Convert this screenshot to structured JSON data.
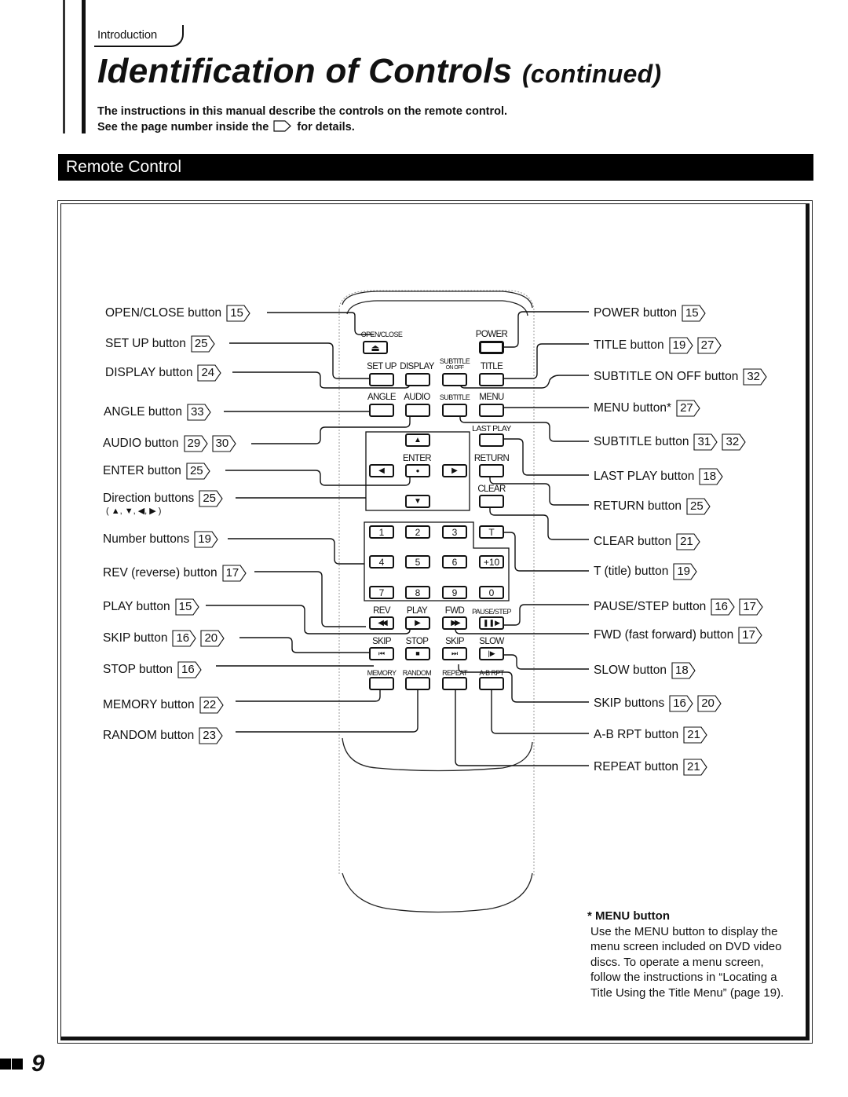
{
  "header": {
    "breadcrumb": "Introduction",
    "title": "Identification of Controls",
    "title_suffix": "(continued)",
    "intro_line1": "The instructions in this manual describe the controls on the remote control.",
    "intro_line2_before": "See the page number inside the",
    "intro_line2_after": "for details."
  },
  "section": {
    "title": "Remote Control"
  },
  "left_labels": [
    {
      "text": "OPEN/CLOSE button",
      "refs": [
        "15"
      ]
    },
    {
      "text": "SET UP button",
      "refs": [
        "25"
      ]
    },
    {
      "text": "DISPLAY button",
      "refs": [
        "24"
      ]
    },
    {
      "text": "ANGLE button",
      "refs": [
        "33"
      ]
    },
    {
      "text": "AUDIO button",
      "refs": [
        "29",
        "30"
      ]
    },
    {
      "text": "ENTER button",
      "refs": [
        "25"
      ]
    },
    {
      "text": "Direction buttons",
      "refs": [
        "25"
      ],
      "subtext": "( ▲, ▼, ◀, ▶ )"
    },
    {
      "text": "Number buttons",
      "refs": [
        "19"
      ]
    },
    {
      "text": "REV (reverse) button",
      "refs": [
        "17"
      ]
    },
    {
      "text": "PLAY button",
      "refs": [
        "15"
      ]
    },
    {
      "text": "SKIP button",
      "refs": [
        "16",
        "20"
      ]
    },
    {
      "text": "STOP button",
      "refs": [
        "16"
      ]
    },
    {
      "text": "MEMORY button",
      "refs": [
        "22"
      ]
    },
    {
      "text": "RANDOM button",
      "refs": [
        "23"
      ]
    }
  ],
  "right_labels": [
    {
      "text": "POWER button",
      "refs": [
        "15"
      ]
    },
    {
      "text": "TITLE button",
      "refs": [
        "19",
        "27"
      ]
    },
    {
      "text": "SUBTITLE ON OFF button",
      "refs": [
        "32"
      ]
    },
    {
      "text": "MENU button*",
      "refs": [
        "27"
      ]
    },
    {
      "text": "SUBTITLE button",
      "refs": [
        "31",
        "32"
      ]
    },
    {
      "text": "LAST PLAY button",
      "refs": [
        "18"
      ]
    },
    {
      "text": "RETURN button",
      "refs": [
        "25"
      ]
    },
    {
      "text": "CLEAR button",
      "refs": [
        "21"
      ]
    },
    {
      "text": "T (title) button",
      "refs": [
        "19"
      ]
    },
    {
      "text": "PAUSE/STEP button",
      "refs": [
        "16",
        "17"
      ]
    },
    {
      "text": "FWD (fast forward) button",
      "refs": [
        "17"
      ]
    },
    {
      "text": "SLOW button",
      "refs": [
        "18"
      ]
    },
    {
      "text": "SKIP buttons",
      "refs": [
        "16",
        "20"
      ]
    },
    {
      "text": "A-B RPT button",
      "refs": [
        "21"
      ]
    },
    {
      "text": "REPEAT button",
      "refs": [
        "21"
      ]
    }
  ],
  "remote": {
    "open_close": "OPEN/CLOSE",
    "power": "POWER",
    "set_up": "SET UP",
    "display": "DISPLAY",
    "subtitle_onoff": "SUBTITLE",
    "subtitle_onoff_sub": "ON OFF",
    "title": "TITLE",
    "angle": "ANGLE",
    "audio": "AUDIO",
    "subtitle": "SUBTITLE",
    "menu": "MENU",
    "last_play": "LAST PLAY",
    "enter": "ENTER",
    "return": "RETURN",
    "clear": "CLEAR",
    "numbers": [
      "1",
      "2",
      "3",
      "T",
      "4",
      "5",
      "6",
      "+10",
      "7",
      "8",
      "9",
      "0"
    ],
    "rev": "REV",
    "play": "PLAY",
    "fwd": "FWD",
    "pause_step": "PAUSE/STEP",
    "skip_back": "SKIP",
    "stop": "STOP",
    "skip_fwd": "SKIP",
    "slow": "SLOW",
    "memory": "MEMORY",
    "random": "RANDOM",
    "repeat": "REPEAT",
    "ab_rpt": "A-B RPT"
  },
  "note": {
    "title": "* MENU button",
    "body": "Use the MENU button to display the menu screen included on DVD video discs. To operate a menu screen, follow the instructions in “Locating a Title Using the Title Menu” (page 19)."
  },
  "page": {
    "number": "9"
  }
}
